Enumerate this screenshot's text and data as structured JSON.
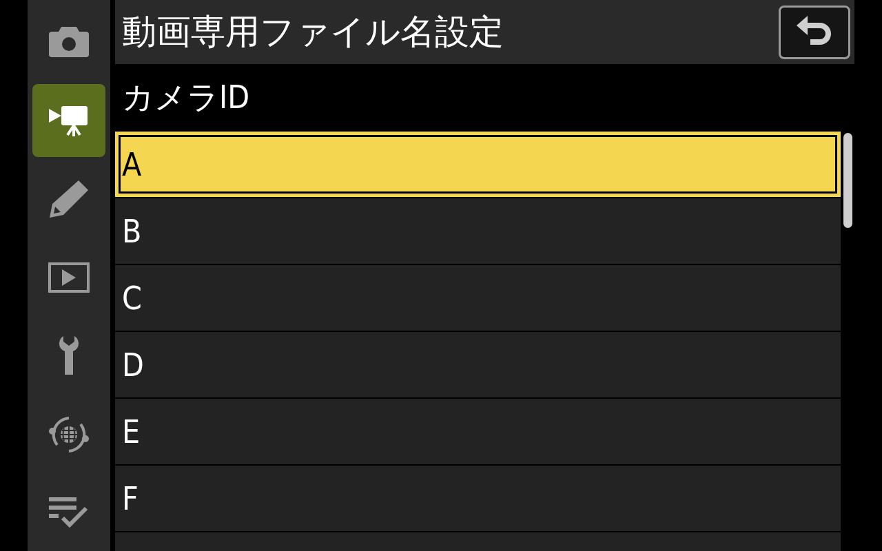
{
  "sidebar": {
    "items": [
      {
        "kind": "camera",
        "selected": false
      },
      {
        "kind": "video",
        "selected": true
      },
      {
        "kind": "pencil",
        "selected": false
      },
      {
        "kind": "playback",
        "selected": false
      },
      {
        "kind": "wrench",
        "selected": false
      },
      {
        "kind": "network",
        "selected": false
      },
      {
        "kind": "checklist",
        "selected": false
      }
    ]
  },
  "header": {
    "title": "動画専用ファイル名設定"
  },
  "subtitle": "カメラID",
  "options": [
    {
      "label": "A",
      "selected": true
    },
    {
      "label": "B",
      "selected": false
    },
    {
      "label": "C",
      "selected": false
    },
    {
      "label": "D",
      "selected": false
    },
    {
      "label": "E",
      "selected": false
    },
    {
      "label": "F",
      "selected": false
    },
    {
      "selected": false
    }
  ]
}
